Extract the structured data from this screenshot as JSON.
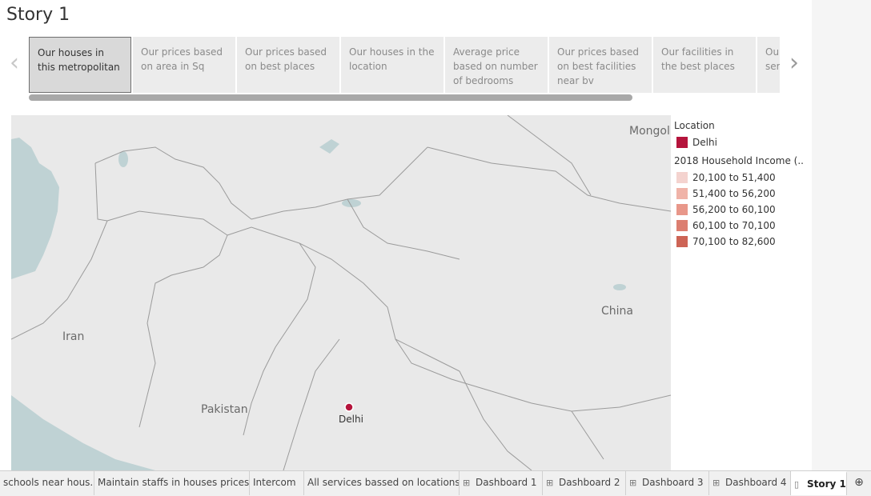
{
  "story": {
    "title": "Story 1"
  },
  "nav": {
    "prev_icon": "chevron-left-icon",
    "next_icon": "chevron-right-icon",
    "prev_glyph": "‹",
    "next_glyph": "›"
  },
  "story_points": [
    "Our houses in this metropolitan",
    "Our prices based on area in Sq",
    "Our prices based on best places",
    "Our houses in the location",
    "Average price based on number of bedrooms",
    "Our prices based on best facilities near bv",
    "Our facilities in the best places",
    "Our houses near services"
  ],
  "map": {
    "labels": {
      "mongolia": "Mongol",
      "china": "China",
      "iran": "Iran",
      "pakistan": "Pakistan",
      "delhi": "Delhi"
    },
    "marker_color": "#b5143c"
  },
  "legend": {
    "location_title": "Location",
    "location_item": "Delhi",
    "location_color": "#b5143c",
    "income_title": "2018 Household Income (..",
    "income_ranges": [
      "20,100 to 51,400",
      "51,400 to 56,200",
      "56,200 to 60,100",
      "60,100 to 70,100",
      "70,100 to 82,600"
    ],
    "income_colors": [
      "#f4d3cf",
      "#f0b3a8",
      "#e8978a",
      "#dc7e70",
      "#cd6455"
    ]
  },
  "tabs": [
    {
      "label": "schools near hous...",
      "icon": ""
    },
    {
      "label": "Maintain staffs in houses prices",
      "icon": ""
    },
    {
      "label": "Intercom",
      "icon": ""
    },
    {
      "label": "All services bassed on locations",
      "icon": ""
    },
    {
      "label": "Dashboard 1",
      "icon": "dashboard-icon"
    },
    {
      "label": "Dashboard 2",
      "icon": "dashboard-icon"
    },
    {
      "label": "Dashboard 3",
      "icon": "dashboard-icon"
    },
    {
      "label": "Dashboard 4",
      "icon": "dashboard-icon"
    },
    {
      "label": "Story 1",
      "icon": "story-icon",
      "active": true
    }
  ],
  "new_sheet_icon": "new-worksheet-icon"
}
